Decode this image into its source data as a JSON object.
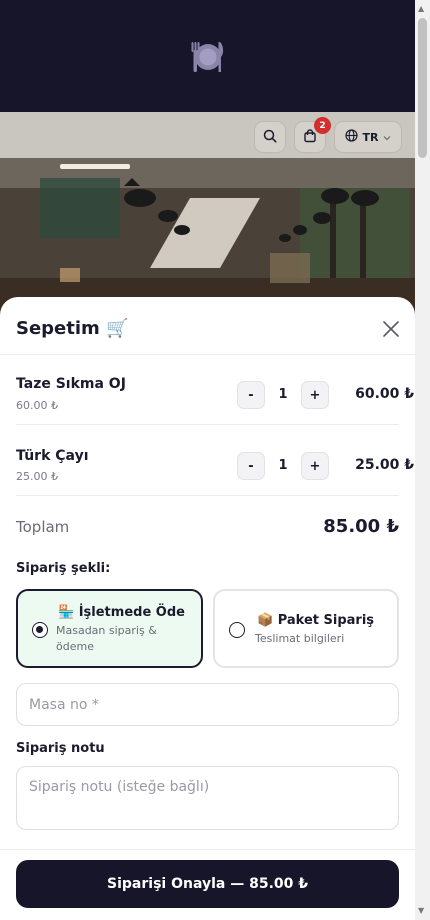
{
  "header": {
    "logo_icon": "plate-cutlery-icon",
    "search_icon": "search-icon",
    "cart_icon": "cart-icon",
    "cart_badge": "2",
    "language": "TR",
    "globe_icon": "globe-icon"
  },
  "cart": {
    "title": "Sepetim 🛒",
    "close_icon": "close-icon",
    "items": [
      {
        "name": "Taze Sıkma OJ",
        "unit_price": "60.00 ₺",
        "qty": "1",
        "line_total": "60.00 ₺",
        "minus": "-",
        "plus": "+"
      },
      {
        "name": "Türk Çayı",
        "unit_price": "25.00 ₺",
        "qty": "1",
        "line_total": "25.00 ₺",
        "minus": "-",
        "plus": "+"
      }
    ],
    "total_label": "Toplam",
    "total_value": "85.00 ₺"
  },
  "order_type": {
    "label": "Sipariş şekli:",
    "options": [
      {
        "title": "🏪 İşletmede Öde",
        "subtitle": "Masadan sipariş & ödeme",
        "selected": true
      },
      {
        "title": "📦 Paket Sipariş",
        "subtitle": "Teslimat bilgileri",
        "selected": false
      }
    ]
  },
  "table_input": {
    "placeholder": "Masa no *"
  },
  "note": {
    "label": "Sipariş notu",
    "placeholder": "Sipariş notu (isteğe bağlı)"
  },
  "confirm_button": "Siparişi Onayla — 85.00 ₺",
  "colors": {
    "dark": "#16152a",
    "selected_bg": "#edfaf1",
    "badge": "#d32f2f"
  }
}
